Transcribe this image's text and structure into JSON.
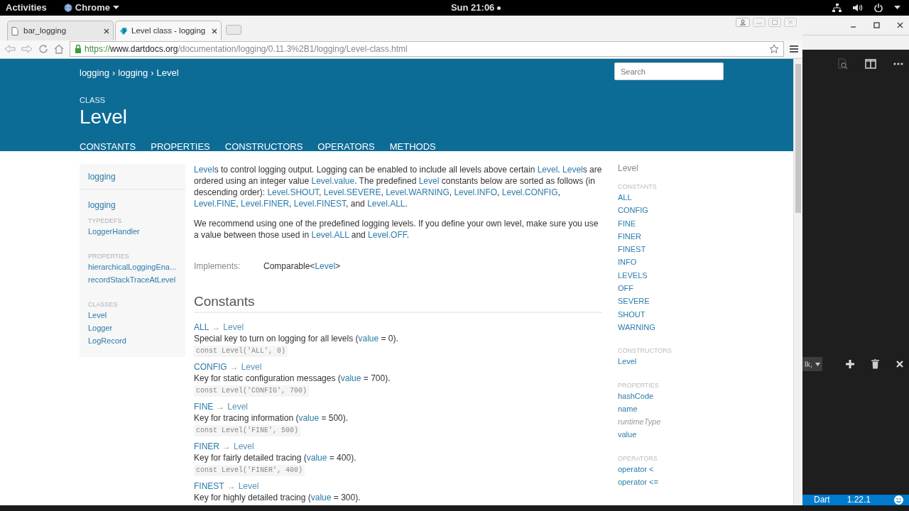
{
  "top_bar": {
    "activities": "Activities",
    "app_menu": "Chrome",
    "clock": "Sun 21:06"
  },
  "browser": {
    "tabs": [
      {
        "title": "bar_logging",
        "kind": "file",
        "selected": false
      },
      {
        "title": "Level class - logging",
        "kind": "dart",
        "selected": true
      }
    ],
    "url": {
      "scheme": "https://",
      "host": "www.dartdocs.org",
      "path": "/documentation/logging/0.11.3%2B1/logging/Level-class.html"
    }
  },
  "page": {
    "breadcrumbs": [
      {
        "label": "logging"
      },
      {
        "separator": "›",
        "label": "logging"
      },
      {
        "separator": "›",
        "label": "Level"
      }
    ],
    "search": {
      "placeholder": "Search"
    },
    "kind_label": "CLASS",
    "title": "Level",
    "nav": [
      "CONSTANTS",
      "PROPERTIES",
      "CONSTRUCTORS",
      "OPERATORS",
      "METHODS"
    ],
    "sidebar": {
      "package": "logging",
      "library": "logging",
      "sections": [
        {
          "heading": "TYPEDEFS",
          "items": [
            "LoggerHandler"
          ]
        },
        {
          "heading": "PROPERTIES",
          "items": [
            "hierarchicalLoggingEna...",
            "recordStackTraceAtLevel"
          ]
        },
        {
          "heading": "CLASSES",
          "items": [
            "Level",
            "Logger",
            "LogRecord"
          ]
        }
      ]
    },
    "description": [
      [
        {
          "text": "Level",
          "link": true
        },
        {
          "text": "s to control logging output. Logging can be enabled to include all levels above certain ",
          "link": false
        },
        {
          "text": "Level",
          "link": true
        },
        {
          "text": ". ",
          "link": false
        },
        {
          "text": "Level",
          "link": true
        },
        {
          "text": "s are ordered using an integer value ",
          "link": false
        },
        {
          "text": "Level.value",
          "link": true
        },
        {
          "text": ". The predefined ",
          "link": false
        },
        {
          "text": "Level",
          "link": true
        },
        {
          "text": " constants below are sorted as follows (in descending order): ",
          "link": false
        },
        {
          "text": "Level.SHOUT",
          "link": true
        },
        {
          "text": ", ",
          "link": false
        },
        {
          "text": "Level.SEVERE",
          "link": true
        },
        {
          "text": ", ",
          "link": false
        },
        {
          "text": "Level.WARNING",
          "link": true
        },
        {
          "text": ", ",
          "link": false
        },
        {
          "text": "Level.INFO",
          "link": true
        },
        {
          "text": ", ",
          "link": false
        },
        {
          "text": "Level.CONFIG",
          "link": true
        },
        {
          "text": ", ",
          "link": false
        },
        {
          "text": "Level.FINE",
          "link": true
        },
        {
          "text": ", ",
          "link": false
        },
        {
          "text": "Level.FINER",
          "link": true
        },
        {
          "text": ", ",
          "link": false
        },
        {
          "text": "Level.FINEST",
          "link": true
        },
        {
          "text": ", and ",
          "link": false
        },
        {
          "text": "Level.ALL",
          "link": true
        },
        {
          "text": ".",
          "link": false
        }
      ],
      [
        {
          "text": "We recommend using one of the predefined logging levels. If you define your own level, make sure you use a value between those used in ",
          "link": false
        },
        {
          "text": "Level.ALL",
          "link": true
        },
        {
          "text": " and ",
          "link": false
        },
        {
          "text": "Level.OFF",
          "link": true
        },
        {
          "text": ".",
          "link": false
        }
      ]
    ],
    "implements": {
      "label": "Implements:",
      "value": [
        {
          "text": "Comparable<",
          "link": false
        },
        {
          "text": "Level",
          "link": true
        },
        {
          "text": ">",
          "link": false
        }
      ]
    },
    "constants_heading": "Constants",
    "constants": [
      {
        "name": "ALL",
        "arrow": "→",
        "type": "Level",
        "description": [
          {
            "text": "Special key to turn on logging for all levels (",
            "link": false
          },
          {
            "text": "value",
            "link": true
          },
          {
            "text": " = 0).",
            "link": false
          }
        ],
        "code": "const Level('ALL', 0)"
      },
      {
        "name": "CONFIG",
        "arrow": "→",
        "type": "Level",
        "description": [
          {
            "text": "Key for static configuration messages (",
            "link": false
          },
          {
            "text": "value",
            "link": true
          },
          {
            "text": " = 700).",
            "link": false
          }
        ],
        "code": "const Level('CONFIG', 700)"
      },
      {
        "name": "FINE",
        "arrow": "→",
        "type": "Level",
        "description": [
          {
            "text": "Key for tracing information (",
            "link": false
          },
          {
            "text": "value",
            "link": true
          },
          {
            "text": " = 500).",
            "link": false
          }
        ],
        "code": "const Level('FINE', 500)"
      },
      {
        "name": "FINER",
        "arrow": "→",
        "type": "Level",
        "description": [
          {
            "text": "Key for fairly detailed tracing (",
            "link": false
          },
          {
            "text": "value",
            "link": true
          },
          {
            "text": " = 400).",
            "link": false
          }
        ],
        "code": "const Level('FINER', 400)"
      },
      {
        "name": "FINEST",
        "arrow": "→",
        "type": "Level",
        "description": [
          {
            "text": "Key for highly detailed tracing (",
            "link": false
          },
          {
            "text": "value",
            "link": true
          },
          {
            "text": " = 300).",
            "link": false
          }
        ]
      }
    ],
    "toc": {
      "title": "Level",
      "sections": [
        {
          "heading": "CONSTANTS",
          "items": [
            {
              "label": "ALL",
              "inherited": false
            },
            {
              "label": "CONFIG",
              "inherited": false
            },
            {
              "label": "FINE",
              "inherited": false
            },
            {
              "label": "FINER",
              "inherited": false
            },
            {
              "label": "FINEST",
              "inherited": false
            },
            {
              "label": "INFO",
              "inherited": false
            },
            {
              "label": "LEVELS",
              "inherited": false
            },
            {
              "label": "OFF",
              "inherited": false
            },
            {
              "label": "SEVERE",
              "inherited": false
            },
            {
              "label": "SHOUT",
              "inherited": false
            },
            {
              "label": "WARNING",
              "inherited": false
            }
          ]
        },
        {
          "heading": "CONSTRUCTORS",
          "items": [
            {
              "label": "Level",
              "inherited": false
            }
          ]
        },
        {
          "heading": "PROPERTIES",
          "items": [
            {
              "label": "hashCode",
              "inherited": false
            },
            {
              "label": "name",
              "inherited": false
            },
            {
              "label": "runtimeType",
              "inherited": true
            },
            {
              "label": "value",
              "inherited": false
            }
          ]
        },
        {
          "heading": "OPERATORS",
          "items": [
            {
              "label": "operator <",
              "inherited": false
            },
            {
              "label": "operator <=",
              "inherited": false
            }
          ]
        }
      ]
    }
  },
  "editor": {
    "terminal_selector": "lk,",
    "status_bar": {
      "language": "Dart",
      "version": "1.22.1"
    }
  }
}
